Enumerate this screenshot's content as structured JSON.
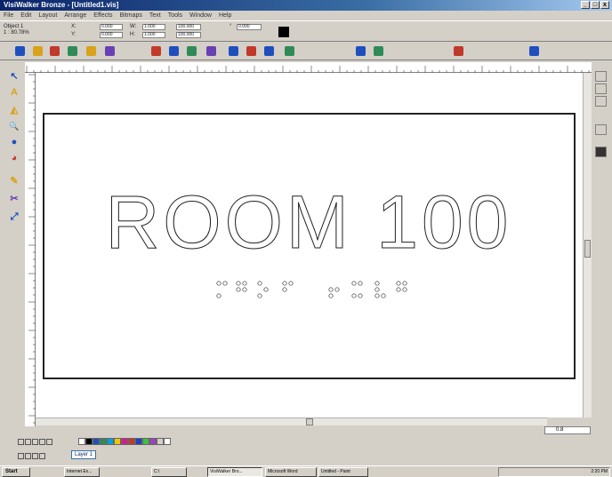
{
  "window": {
    "title": "VisiWalker Bronze - [Untitled1.vis]",
    "controls": [
      "_",
      "□",
      "x"
    ]
  },
  "menu": [
    "File",
    "Edit",
    "Layout",
    "Arrange",
    "Effects",
    "Bitmaps",
    "Text",
    "Tools",
    "Window",
    "Help"
  ],
  "property_bar": {
    "object_info": [
      "Object 1",
      "1 : 80.78%"
    ],
    "x": "0.000",
    "y": "0.000",
    "w": "1.000",
    "h": "1.000",
    "sx": "100.000",
    "sy": "100.000",
    "angle": "0.000",
    "labels": {
      "x": "X:",
      "y": "Y:",
      "w": "W:",
      "h": "H:",
      "angle": "°"
    }
  },
  "toolbar": {
    "icons": [
      "new-icon",
      "open-icon",
      "save-icon",
      "print-icon",
      "cut-icon",
      "undo-icon",
      "redo-icon",
      "import-icon",
      "export-icon",
      "zoom-icon",
      "grid-icon",
      "node-icon",
      "weld-icon",
      "trim-icon",
      "text-icon",
      "color-icon",
      "fill-icon",
      "outline-icon"
    ],
    "accent_colors": [
      "#1f4fbf",
      "#d8a21b",
      "#c0392b",
      "#2e8b57",
      "#6a3fb5"
    ]
  },
  "tools": [
    {
      "name": "pick-tool-icon",
      "glyph": "↖"
    },
    {
      "name": "text-tool-icon",
      "glyph": "A"
    },
    {
      "name": "shape-tool-icon",
      "glyph": "◭"
    },
    {
      "name": "zoom-tool-icon",
      "glyph": "🔍"
    },
    {
      "name": "fill-tool-icon",
      "glyph": "●"
    },
    {
      "name": "ellipse-tool-icon",
      "glyph": "◕"
    },
    {
      "name": "pen-tool-icon",
      "glyph": "✎"
    },
    {
      "name": "knife-tool-icon",
      "glyph": "✂"
    },
    {
      "name": "measure-tool-icon",
      "glyph": "⤢"
    }
  ],
  "canvas": {
    "sign_text": "ROOM 100",
    "braille_cells": 8,
    "border_color": "#222222"
  },
  "status": {
    "zoom": "0.8"
  },
  "color_palette": [
    "#ffffff",
    "#000000",
    "#1f4fbf",
    "#2e8b57",
    "#00a0e0",
    "#f2c500",
    "#d81b8c",
    "#c0392b",
    "#2040c0",
    "#40c040",
    "#a040c0",
    "#d4d0c8",
    "#ffffff"
  ],
  "layers": {
    "active": "Layer 1"
  },
  "taskbar": {
    "start_label": "Start",
    "tasks": [
      {
        "label": "Internet Ex...",
        "active": false
      },
      {
        "label": "C:\\",
        "active": false
      },
      {
        "label": "VisiWalker Bro...",
        "active": true
      },
      {
        "label": "Microsoft Word",
        "active": false
      },
      {
        "label": "Untitled - Paint",
        "active": false
      }
    ],
    "clock": "2:20 PM"
  }
}
